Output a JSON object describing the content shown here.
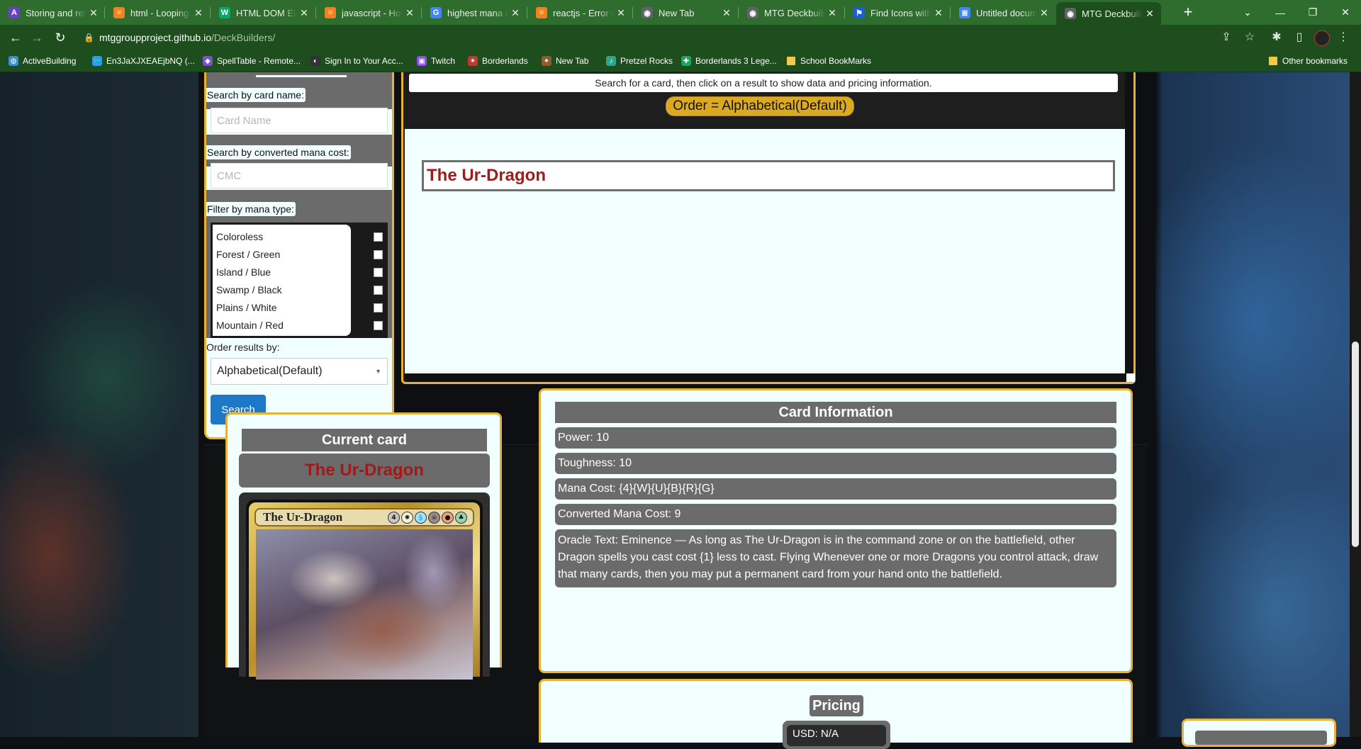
{
  "browser": {
    "tabs": [
      {
        "title": "Storing and retr",
        "favicon_color": "#6b3fc8",
        "favicon_glyph": "A"
      },
      {
        "title": "html - Looping t",
        "favicon_color": "#f48024",
        "favicon_glyph": "≡"
      },
      {
        "title": "HTML DOM Elem",
        "favicon_color": "#04aa6d",
        "favicon_glyph": "W"
      },
      {
        "title": "javascript - How",
        "favicon_color": "#f48024",
        "favicon_glyph": "≡"
      },
      {
        "title": "highest mana cc",
        "favicon_color": "#4285f4",
        "favicon_glyph": "G"
      },
      {
        "title": "reactjs - Error w",
        "favicon_color": "#f48024",
        "favicon_glyph": "≡"
      },
      {
        "title": "New Tab",
        "favicon_color": "#5f6368",
        "favicon_glyph": "◉"
      },
      {
        "title": "MTG Deckbuilde",
        "favicon_color": "#5f6368",
        "favicon_glyph": "◉"
      },
      {
        "title": "Find Icons with",
        "favicon_color": "#1e5bd6",
        "favicon_glyph": "⚑"
      },
      {
        "title": "Untitled docum",
        "favicon_color": "#4285f4",
        "favicon_glyph": "≣"
      },
      {
        "title": "MTG Deckbuilde",
        "favicon_color": "#5f6368",
        "favicon_glyph": "◉",
        "active": true
      }
    ],
    "url_host": "mtggroupproject.github.io",
    "url_path": "/DeckBuilders/",
    "bookmarks": [
      {
        "label": "ActiveBuilding",
        "color": "#3a8fd0",
        "glyph": "◍"
      },
      {
        "label": "En3JaXJXEAEjbNQ (...",
        "color": "#1da1f2",
        "glyph": "🐦"
      },
      {
        "label": "SpellTable - Remote...",
        "color": "#7a4fd0",
        "glyph": "◆"
      },
      {
        "label": "Sign In to Your Acc...",
        "color": "#333333",
        "glyph": "◐"
      },
      {
        "label": "Twitch",
        "color": "#9146ff",
        "glyph": "▣"
      },
      {
        "label": "Borderlands",
        "color": "#c0392b",
        "glyph": "✶"
      },
      {
        "label": "New Tab",
        "color": "#8e5d2c",
        "glyph": "✦"
      },
      {
        "label": "Pretzel Rocks",
        "color": "#2ca58d",
        "glyph": "♪"
      },
      {
        "label": "Borderlands 3 Lege...",
        "color": "#1aa75a",
        "glyph": "✚"
      },
      {
        "label": "School BookMarks",
        "folder": true
      }
    ],
    "other_bookmarks": "Other bookmarks"
  },
  "search_panel": {
    "card_name_label": "Search by card name:",
    "card_name_placeholder": "Card Name",
    "cmc_label": "Search by converted mana cost:",
    "cmc_placeholder": "CMC",
    "mana_label": "Filter by mana type:",
    "mana_types": [
      "Coloroless",
      "Forest / Green",
      "Island / Blue",
      "Swamp / Black",
      "Plains / White",
      "Mountain / Red"
    ],
    "order_label": "Order results by:",
    "order_selected": "Alphabetical(Default)",
    "search_button": "Search"
  },
  "results": {
    "hint": "Search for a card, then click on a result to show data and pricing information.",
    "order_display": "Order = Alphabetical(Default)",
    "items": [
      "The Ur-Dragon"
    ]
  },
  "current_card": {
    "heading": "Current card",
    "name": "The Ur-Dragon",
    "card_title": "The Ur-Dragon",
    "mana_symbols": [
      {
        "glyph": "4",
        "color": "#cac5c0"
      },
      {
        "glyph": "✺",
        "color": "#f8f4d6"
      },
      {
        "glyph": "💧",
        "color": "#aae0fa"
      },
      {
        "glyph": "☠",
        "color": "#9c8a8a"
      },
      {
        "glyph": "●",
        "color": "#f2a07a"
      },
      {
        "glyph": "♣",
        "color": "#9bd3ae"
      }
    ]
  },
  "card_info": {
    "heading": "Card Information",
    "power": "Power: 10",
    "toughness": "Toughness: 10",
    "mana_cost": "Mana Cost: {4}{W}{U}{B}{R}{G}",
    "cmc": "Converted Mana Cost: 9",
    "oracle": "Oracle Text: Eminence — As long as The Ur-Dragon is in the command zone or on the battlefield, other Dragon spells you cast cost {1} less to cast. Flying Whenever one or more Dragons you control attack, draw that many cards, then you may put a permanent card from your hand onto the battlefield."
  },
  "pricing": {
    "heading": "Pricing",
    "usd": "USD: N/A"
  },
  "colors": {
    "chrome_green": "#1e4d1e",
    "panel_bg": "#f1ffff",
    "gold_border": "#e6b338",
    "card_name_red": "#9b1d1d",
    "order_pill": "#dcaa22",
    "button_blue": "#1e78c8"
  }
}
